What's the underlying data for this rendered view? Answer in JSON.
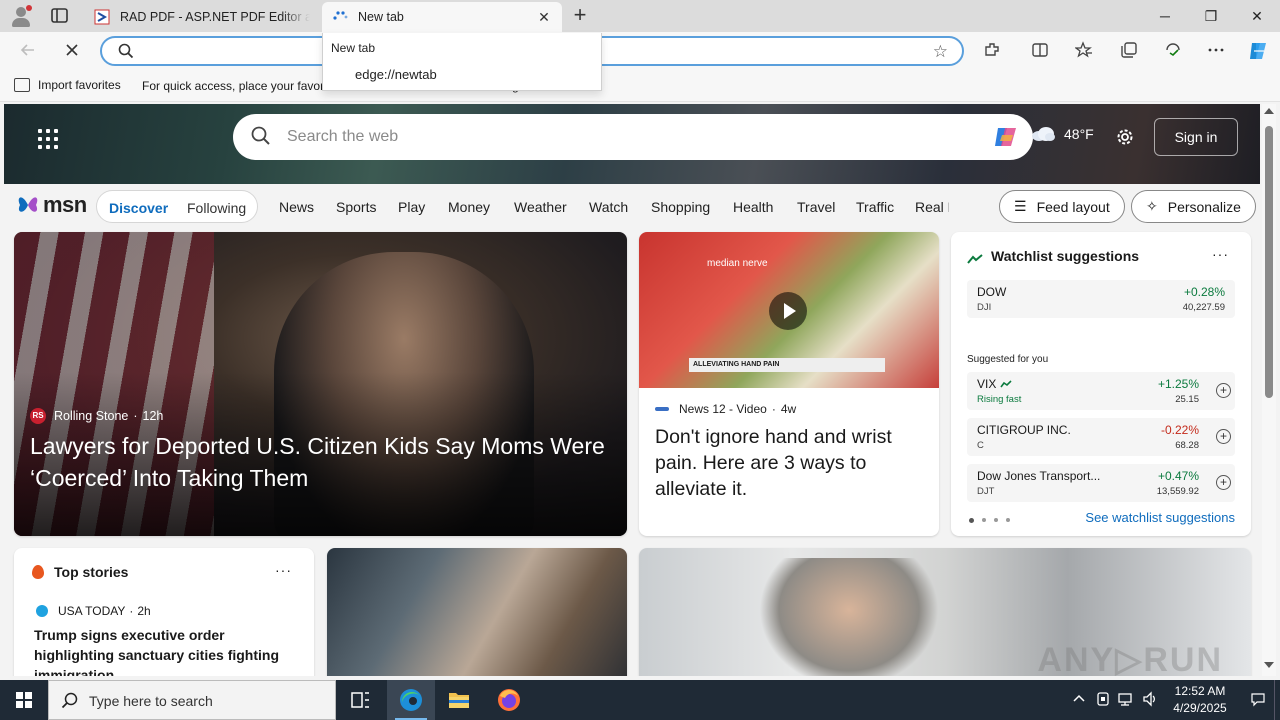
{
  "browser": {
    "tabs": [
      {
        "title": "RAD PDF - ASP.NET PDF Editor and",
        "favicon": "radpdf-icon"
      },
      {
        "title": "New tab",
        "favicon": "loading-icon"
      }
    ],
    "new_tab_symbol": "+",
    "close_symbol": "✕",
    "window_controls": {
      "minimize": "─",
      "restore": "❐",
      "close": "✕"
    },
    "omnibox": {
      "value": "",
      "placeholder": ""
    },
    "dropdown": {
      "header": "New tab",
      "suggestion": "edge://newtab"
    },
    "favorites_bar": {
      "import_label": "Import favorites",
      "hint": "For quick access, place your favorites here on the favorites bar. Manage favorites now"
    }
  },
  "msn": {
    "search_placeholder": "Search the web",
    "weather": {
      "temp": "48°F",
      "icon": "cloud-icon"
    },
    "sign_in": "Sign in",
    "logo_text": "msn",
    "feed_tabs": {
      "discover": "Discover",
      "following": "Following"
    },
    "nav_links": [
      "News",
      "Sports",
      "Play",
      "Money",
      "Weather",
      "Watch",
      "Shopping",
      "Health",
      "Travel",
      "Traffic",
      "Real Es"
    ],
    "feed_layout": "Feed layout",
    "personalize": "Personalize",
    "main_story": {
      "source": "Rolling Stone",
      "source_badge": "RS",
      "age": "12h",
      "headline": "Lawyers for Deported U.S. Citizen Kids Say Moms Were ‘Coerced’ Into Taking Them"
    },
    "video_story": {
      "source": "News 12 - Video",
      "age": "4w",
      "image_label": "median nerve",
      "image_banner": "ALLEVIATING HAND PAIN",
      "headline": "Don't ignore hand and wrist pain. Here are 3 ways to alleviate it."
    },
    "watchlist": {
      "title": "Watchlist suggestions",
      "more": "···",
      "suggested_label": "Suggested for you",
      "see_more": "See watchlist suggestions",
      "items": [
        {
          "name": "DOW",
          "sub": "DJI",
          "change": "+0.28%",
          "value": "40,227.59",
          "direction": "up",
          "addable": false
        },
        {
          "name": "VIX",
          "sub": "Rising fast",
          "change": "+1.25%",
          "value": "25.15",
          "direction": "up",
          "addable": true
        },
        {
          "name": "CITIGROUP INC.",
          "sub": "C",
          "change": "-0.22%",
          "value": "68.28",
          "direction": "down",
          "addable": true
        },
        {
          "name": "Dow Jones Transport...",
          "sub": "DJT",
          "change": "+0.47%",
          "value": "13,559.92",
          "direction": "up",
          "addable": true
        }
      ]
    },
    "top_stories": {
      "title": "Top stories",
      "more": "···",
      "source": "USA TODAY",
      "age": "2h",
      "headline": "Trump signs executive order highlighting sanctuary cities fighting immigration..."
    }
  },
  "taskbar": {
    "search_placeholder": "Type here to search",
    "time": "12:52 AM",
    "date": "4/29/2025"
  },
  "colors": {
    "accent": "#0f6cbd",
    "up": "#0b7a3e",
    "down": "#c42b1c"
  }
}
